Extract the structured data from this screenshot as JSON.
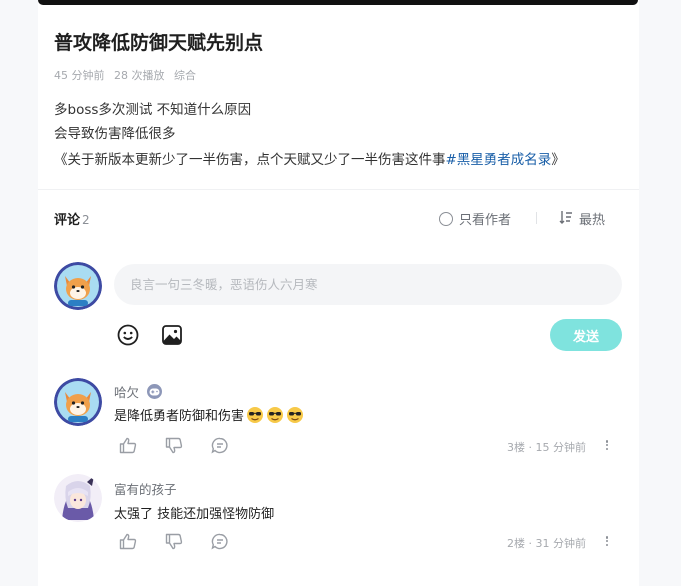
{
  "post": {
    "title": "普攻降低防御天赋先别点",
    "meta": {
      "time": "45 分钟前",
      "plays": "28 次播放",
      "category": "综合"
    },
    "description": {
      "line1": "多boss多次测试 不知道什么原因",
      "line2": "会导致伤害降低很多",
      "line3_prefix": "《关于新版本更新少了一半伤害，点个天赋又少了一半伤害这件事",
      "line3_hashtag": "#黑星勇者成名录",
      "line3_suffix": "》"
    }
  },
  "comments_section": {
    "label": "评论",
    "count": "2",
    "only_author": "只看作者",
    "sort": "最热",
    "input_placeholder": "良言一句三冬暖，恶语伤人六月寒",
    "send_label": "发送"
  },
  "comments": [
    {
      "user": "哈欠",
      "text": "是降低勇者防御和伤害",
      "floor": "3楼",
      "time": "15 分钟前"
    },
    {
      "user": "富有的孩子",
      "text": "太强了 技能还加强怪物防御",
      "floor": "2楼",
      "time": "31 分钟前"
    }
  ],
  "colors": {
    "accent": "#7fe3de",
    "hashtag": "#1a5fa8"
  },
  "icons": [
    "emoji-icon",
    "image-icon",
    "like-icon",
    "dislike-icon",
    "reply-icon",
    "more-icon",
    "game-badge-icon",
    "sort-icon"
  ]
}
